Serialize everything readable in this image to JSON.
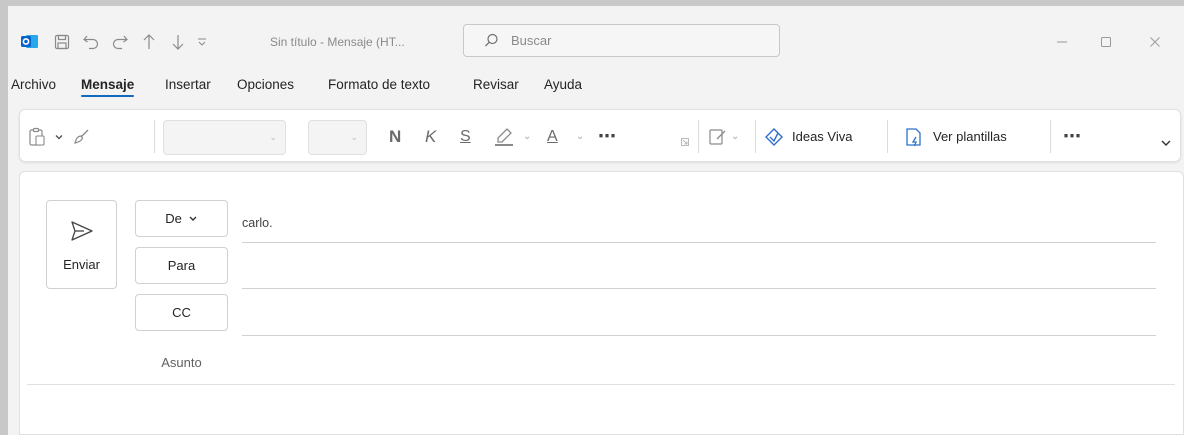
{
  "window": {
    "title": "Sin título  -  Mensaje (HT...",
    "search_placeholder": "Buscar"
  },
  "menu": {
    "tabs": [
      {
        "label": "Archivo",
        "active": false
      },
      {
        "label": "Mensaje",
        "active": true
      },
      {
        "label": "Insertar",
        "active": false
      },
      {
        "label": "Opciones",
        "active": false
      },
      {
        "label": "Formato de texto",
        "active": false
      },
      {
        "label": "Revisar",
        "active": false
      },
      {
        "label": "Ayuda",
        "active": false
      }
    ]
  },
  "ribbon": {
    "bold": "N",
    "italic": "K",
    "underline": "S",
    "font_color": "A",
    "more": "⋯",
    "ideas": "Ideas Viva",
    "templates": "Ver plantillas"
  },
  "compose": {
    "send_label": "Enviar",
    "from_label": "De",
    "from_value": "carlo.",
    "to_label": "Para",
    "cc_label": "CC",
    "subject_label": "Asunto"
  },
  "colors": {
    "accent": "#0f6cbd",
    "outlook_blue": "#0a64c8"
  }
}
